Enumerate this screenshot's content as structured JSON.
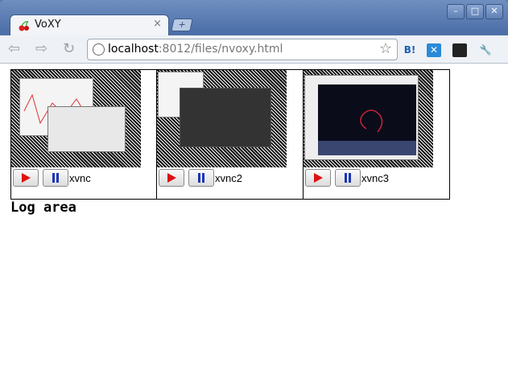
{
  "browser": {
    "tab_title": "VoXY",
    "tab_close": "×",
    "new_tab": "+",
    "url_host": "localhost",
    "url_rest": ":8012/files/nvoxy.html",
    "window_buttons": [
      "–",
      "□",
      "✕"
    ]
  },
  "extensions": [
    "B!",
    "✕",
    "",
    "🔧"
  ],
  "panels": [
    {
      "label": "xvnc"
    },
    {
      "label": "xvnc2"
    },
    {
      "label": "xvnc3"
    }
  ],
  "log": {
    "heading": "Log area"
  },
  "colors": {
    "play": "#dd1111",
    "pause": "#1b35b5",
    "chrome": "#4d6fa8"
  }
}
